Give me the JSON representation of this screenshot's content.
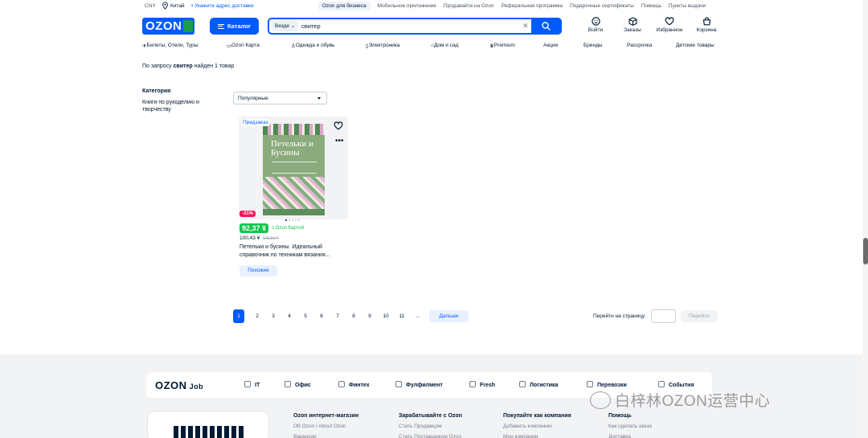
{
  "topbar": {
    "currency": "CNY",
    "city": "Китай",
    "address_link": "• Укажите адрес доставки",
    "links": [
      "Ozon для бизнеса",
      "Мобильное приложение",
      "Продавайте на Ozon",
      "Реферальная программа",
      "Подарочные сертификаты",
      "Помощь",
      "Пункты выдачи"
    ]
  },
  "header": {
    "logo": "OZON",
    "catalog_label": "Каталог",
    "search": {
      "scope": "Везде",
      "query": "свитер"
    },
    "actions": [
      {
        "label": "Войти",
        "icon": "user-icon"
      },
      {
        "label": "Заказы",
        "icon": "box-icon"
      },
      {
        "label": "Избранное",
        "icon": "heart-icon"
      },
      {
        "label": "Корзина",
        "icon": "cart-icon"
      }
    ]
  },
  "nav": [
    "Билеты, Отели, Туры",
    "Ozon Карта",
    "Одежда и обувь",
    "Электроника",
    "Дом и сад",
    "Premium",
    "Акции",
    "Бренды",
    "Рассрочка",
    "Детские товары"
  ],
  "result": {
    "prefix": "По запросу",
    "query": "свитер",
    "suffix": "найден 1 товар"
  },
  "filters": {
    "title": "Категория",
    "item": "Книги по рукоделию и творчеству"
  },
  "sort": {
    "selected": "Популярные"
  },
  "product": {
    "badge": "Предзаказ",
    "book_title": "Петельки и Бусины",
    "discount": "-31%",
    "ozon_price": "92,37 ¥",
    "ozon_price_note": "с Ozon Картой",
    "price": "100,43 ¥",
    "old_price": "145,56 ¥",
    "title": "Петельки и бусины. Идеальный справочник по техникам вязания...",
    "similar_label": "Похожие"
  },
  "pagination": {
    "pages": [
      "1",
      "2",
      "3",
      "4",
      "5",
      "6",
      "7",
      "8",
      "9",
      "10",
      "11",
      "..."
    ],
    "next_label": "Дальше",
    "goto_label": "Перейти на страницу",
    "goto_button": "Перейти"
  },
  "footer": {
    "job_logo": "OZON",
    "job_suffix": "Job",
    "job_items": [
      "IT",
      "Офис",
      "Финтех",
      "Фулфилмент",
      "Fresh",
      "Логистика",
      "Перевозки",
      "События"
    ],
    "columns": [
      {
        "title": "Ozon интернет-магазин",
        "links": [
          "Об Ozon / About Ozon",
          "Вакансии"
        ]
      },
      {
        "title": "Зарабатывайте с Ozon",
        "links": [
          "Стать Продавцом",
          "Стать Поставщиком Ozon"
        ]
      },
      {
        "title": "Покупайте как компания",
        "links": [
          "Добавить компанию",
          "Мои компании"
        ]
      },
      {
        "title": "Помощь",
        "links": [
          "Как сделать заказ",
          "Доставка"
        ]
      }
    ]
  },
  "watermark": "白梓林OZON运营中心",
  "colors": {
    "brand": "#005bff",
    "discount": "#f91155",
    "ozon_card_price": "#10c44c"
  }
}
